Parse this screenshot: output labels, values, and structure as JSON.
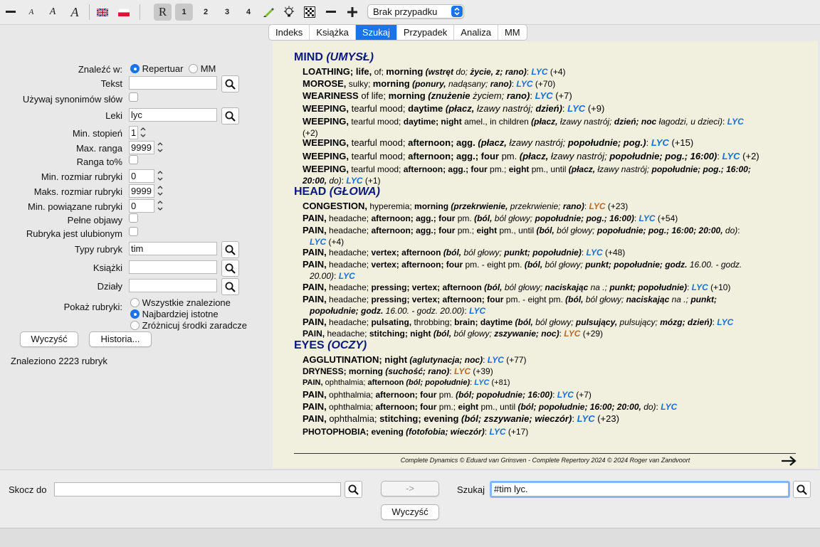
{
  "toolbar": {
    "select_value": "Brak przypadku",
    "btn_r": "R",
    "btn_1": "1",
    "btn_2": "2",
    "btn_3": "3",
    "btn_4": "4",
    "text_small": "A",
    "text_mid": "A",
    "text_big": "A",
    "icons": [
      "minus-icon",
      "font-smaller-icon",
      "font-normal-icon",
      "font-larger-icon",
      "flag-uk-icon",
      "flag-poland-icon",
      "rubric-icon",
      "highlighter-icon",
      "lightbulb-icon",
      "grid-icon",
      "zoom-out-icon",
      "zoom-in-icon"
    ]
  },
  "tabs": [
    {
      "label": "Indeks"
    },
    {
      "label": "Książka"
    },
    {
      "label": "Szukaj",
      "active": true
    },
    {
      "label": "Przypadek"
    },
    {
      "label": "Analiza"
    },
    {
      "label": "MM"
    }
  ],
  "search_form": {
    "find_in_label": "Znaleźć w:",
    "radio_repertuar": "Repertuar",
    "radio_mm": "MM",
    "text_label": "Tekst",
    "text_value": "",
    "synonyms_label": "Używaj synonimów słów",
    "remedies_label": "Leki",
    "remedies_value": "lyc",
    "min_grade_label": "Min. stopień",
    "min_grade_value": "1",
    "max_rank_label": "Max. ranga",
    "max_rank_value": "9999",
    "rank_to_label": "Ranga to%",
    "min_rubric_size_label": "Min. rozmiar rubryki",
    "min_rubric_size_value": "0",
    "max_rubric_size_label": "Maks. rozmiar rubryki",
    "max_rubric_size_value": "9999",
    "min_related_label": "Min. powiązane rubryki",
    "min_related_value": "0",
    "full_symptoms_label": "Pełne objawy",
    "favorite_label": "Rubryka jest ulubionym",
    "rubric_types_label": "Typy rubryk",
    "rubric_types_value": "tim",
    "books_label": "Książki",
    "books_value": "",
    "sections_label": "Działy",
    "sections_value": "",
    "show_label": "Pokaż rubryki:",
    "show_all": "Wszystkie znalezione",
    "show_relevant": "Najbardziej istotne",
    "show_diff": "Zróżnicuj środki zaradcze",
    "clear_button": "Wyczyść",
    "history_button": "Historia...",
    "result_count": "Znaleziono 2223 rubryk"
  },
  "results": {
    "sections": [
      {
        "title": "MIND",
        "trans": "(UMYSŁ)"
      },
      {
        "title": "HEAD",
        "trans": "(GŁOWA)"
      },
      {
        "title": "EYES",
        "trans": "(OCZY)"
      }
    ],
    "footer": "Complete Dynamics © Eduard van Grinsven   -   Complete Repertory 2024 © 2024 Roger van Zandvoort"
  },
  "bottom": {
    "jump_label": "Skocz do",
    "jump_value": "",
    "arrow_button": "->",
    "search_label": "Szukaj",
    "search_value": "#tim lyc.",
    "clear_button": "Wyczyść"
  }
}
